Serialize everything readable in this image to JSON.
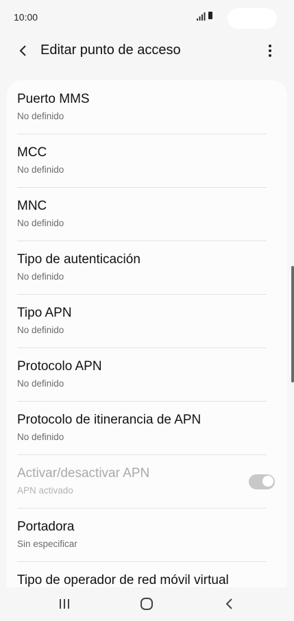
{
  "status": {
    "time": "10:00"
  },
  "header": {
    "title": "Editar punto de acceso"
  },
  "settings": [
    {
      "title": "Puerto MMS",
      "subtitle": "No definido"
    },
    {
      "title": "MCC",
      "subtitle": "No definido"
    },
    {
      "title": "MNC",
      "subtitle": "No definido"
    },
    {
      "title": "Tipo de autenticación",
      "subtitle": "No definido"
    },
    {
      "title": "Tipo APN",
      "subtitle": "No definido"
    },
    {
      "title": "Protocolo APN",
      "subtitle": "No definido"
    },
    {
      "title": "Protocolo de itinerancia de APN",
      "subtitle": "No definido"
    },
    {
      "title": "Activar/desactivar APN",
      "subtitle": "APN activado",
      "toggle_on": true,
      "disabled": true
    },
    {
      "title": "Portadora",
      "subtitle": "Sin especificar"
    },
    {
      "title": "Tipo de operador de red móvil virtual",
      "subtitle": ""
    }
  ],
  "icons": {
    "back": "chevron-left-icon",
    "more": "more-vertical-icon",
    "recents": "recent-apps-icon",
    "home": "home-icon",
    "nav_back": "back-icon"
  }
}
